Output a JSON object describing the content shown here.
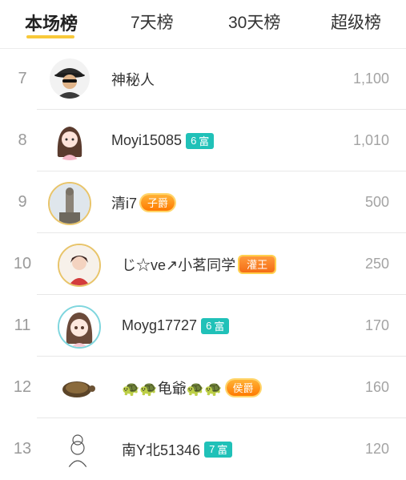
{
  "tabs": [
    {
      "label": "本场榜",
      "active": true
    },
    {
      "label": "7天榜",
      "active": false
    },
    {
      "label": "30天榜",
      "active": false
    },
    {
      "label": "超级榜",
      "active": false
    }
  ],
  "rows": [
    {
      "rank": "7",
      "name": "神秘人",
      "badge": null,
      "score": "1,100",
      "avatar": "mystery-man"
    },
    {
      "rank": "8",
      "name": "Moyi15085",
      "badge": {
        "type": "rich",
        "num": "6",
        "text": "富"
      },
      "score": "1,010",
      "avatar": "girl-pink"
    },
    {
      "rank": "9",
      "name": "清i7",
      "badge": {
        "type": "noble",
        "text": "子爵"
      },
      "score": "500",
      "avatar": "statue"
    },
    {
      "rank": "10",
      "name": "じ☆ve↗小茗同学",
      "badge": {
        "type": "mate",
        "text": "灌王"
      },
      "score": "250",
      "avatar": "doll"
    },
    {
      "rank": "11",
      "name": "Moyg17727",
      "badge": {
        "type": "rich",
        "num": "6",
        "text": "富"
      },
      "score": "170",
      "avatar": "anime-girl"
    },
    {
      "rank": "12",
      "name": "🐢🐢龟爺🐢🐢",
      "badge": {
        "type": "noble",
        "text": "侯爵"
      },
      "score": "160",
      "avatar": "turtle"
    },
    {
      "rank": "13",
      "name": "南Y北51346",
      "badge": {
        "type": "rich",
        "num": "7",
        "text": "富"
      },
      "score": "120",
      "avatar": "sketch-girl"
    }
  ],
  "colors": {
    "accent": "#f8c93a",
    "rich_badge": "#20c1b8",
    "noble_badge": "#ff9a1f"
  }
}
